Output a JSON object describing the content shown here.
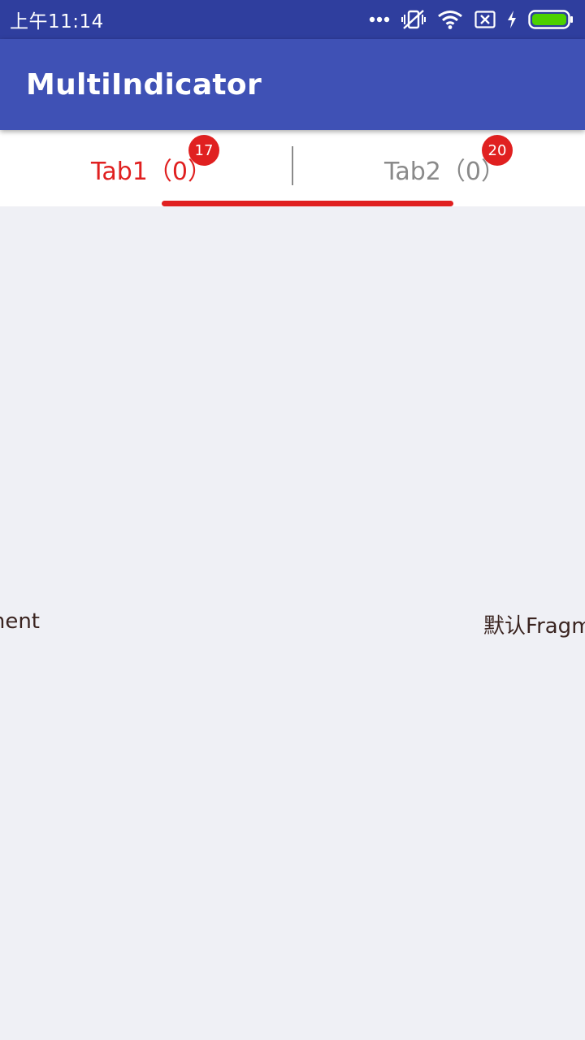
{
  "status_bar": {
    "time": "上午11:14",
    "icons": [
      "more-dots-icon",
      "vibrate-off-icon",
      "wifi-icon",
      "no-sim-icon",
      "charging-icon",
      "battery-icon"
    ],
    "background": "#2F3E9E",
    "battery_color": "#4CD100"
  },
  "app_bar": {
    "title": "MultiIndicator",
    "background": "#3F51B5"
  },
  "tabs": [
    {
      "label": "Tab1（0）",
      "badge": "17",
      "selected": true
    },
    {
      "label": "Tab2（0）",
      "badge": "20",
      "selected": false
    }
  ],
  "colors": {
    "accent": "#E02020",
    "inactive_tab": "#8A8A8A",
    "content_bg": "#EFF0F5",
    "fragment_text": "#3A2420"
  },
  "content": {
    "left_fragment_text": "ment",
    "right_fragment_text": "默认Fragm"
  }
}
